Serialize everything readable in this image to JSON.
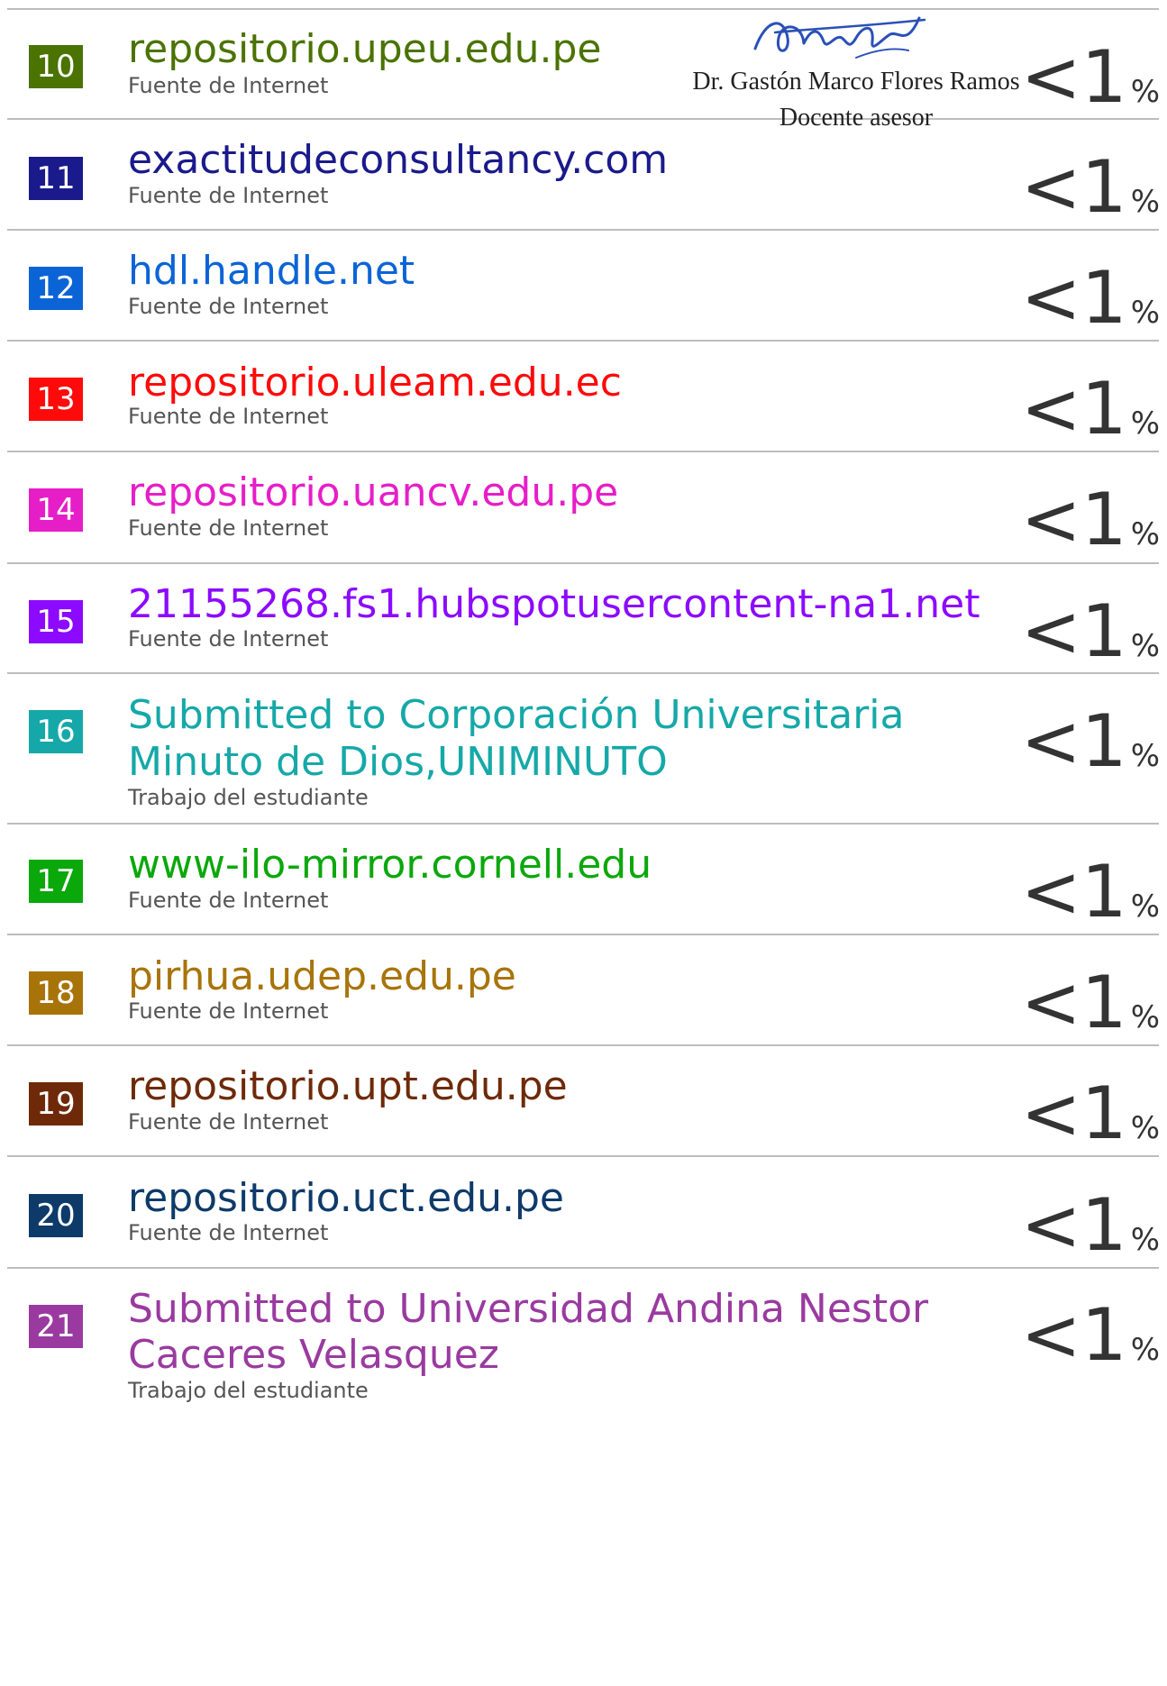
{
  "rows": [
    {
      "number": "10",
      "title": "repositorio.upeu.edu.pe",
      "title2": "",
      "type": "Fuente de Internet",
      "percent": "<1",
      "unit": "%",
      "color": "#4a7300"
    },
    {
      "number": "11",
      "title": "exactitudeconsultancy.com",
      "title2": "",
      "type": "Fuente de Internet",
      "percent": "<1",
      "unit": "%",
      "color": "#1a1a8c"
    },
    {
      "number": "12",
      "title": "hdl.handle.net",
      "title2": "",
      "type": "Fuente de Internet",
      "percent": "<1",
      "unit": "%",
      "color": "#0a64d6"
    },
    {
      "number": "13",
      "title": "repositorio.uleam.edu.ec",
      "title2": "",
      "type": "Fuente de Internet",
      "percent": "<1",
      "unit": "%",
      "color": "#ff0a0a"
    },
    {
      "number": "14",
      "title": "repositorio.uancv.edu.pe",
      "title2": "",
      "type": "Fuente de Internet",
      "percent": "<1",
      "unit": "%",
      "color": "#e61ec8"
    },
    {
      "number": "15",
      "title": "21155268.fs1.hubspotusercontent-na1.net",
      "title2": "",
      "type": "Fuente de Internet",
      "percent": "<1",
      "unit": "%",
      "color": "#8c0aff"
    },
    {
      "number": "16",
      "title": "Submitted to Corporación Universitaria",
      "title2": "Minuto de Dios,UNIMINUTO",
      "type": "Trabajo del estudiante",
      "percent": "<1",
      "unit": "%",
      "color": "#16a8a8"
    },
    {
      "number": "17",
      "title": "www-ilo-mirror.cornell.edu",
      "title2": "",
      "type": "Fuente de Internet",
      "percent": "<1",
      "unit": "%",
      "color": "#0aa80a"
    },
    {
      "number": "18",
      "title": "pirhua.udep.edu.pe",
      "title2": "",
      "type": "Fuente de Internet",
      "percent": "<1",
      "unit": "%",
      "color": "#a8740a"
    },
    {
      "number": "19",
      "title": "repositorio.upt.edu.pe",
      "title2": "",
      "type": "Fuente de Internet",
      "percent": "<1",
      "unit": "%",
      "color": "#6e2a08"
    },
    {
      "number": "20",
      "title": "repositorio.uct.edu.pe",
      "title2": "",
      "type": "Fuente de Internet",
      "percent": "<1",
      "unit": "%",
      "color": "#0e3a6a"
    },
    {
      "number": "21",
      "title": "Submitted to Universidad Andina Nestor",
      "title2": "Caceres Velasquez",
      "type": "Trabajo del estudiante",
      "percent": "<1",
      "unit": "%",
      "color": "#9a3aa0"
    }
  ],
  "stamp": {
    "signature": "GloreRamos",
    "name": "Dr. Gastón Marco Flores Ramos",
    "role": "Docente asesor",
    "ink_color": "#2a50b8"
  }
}
